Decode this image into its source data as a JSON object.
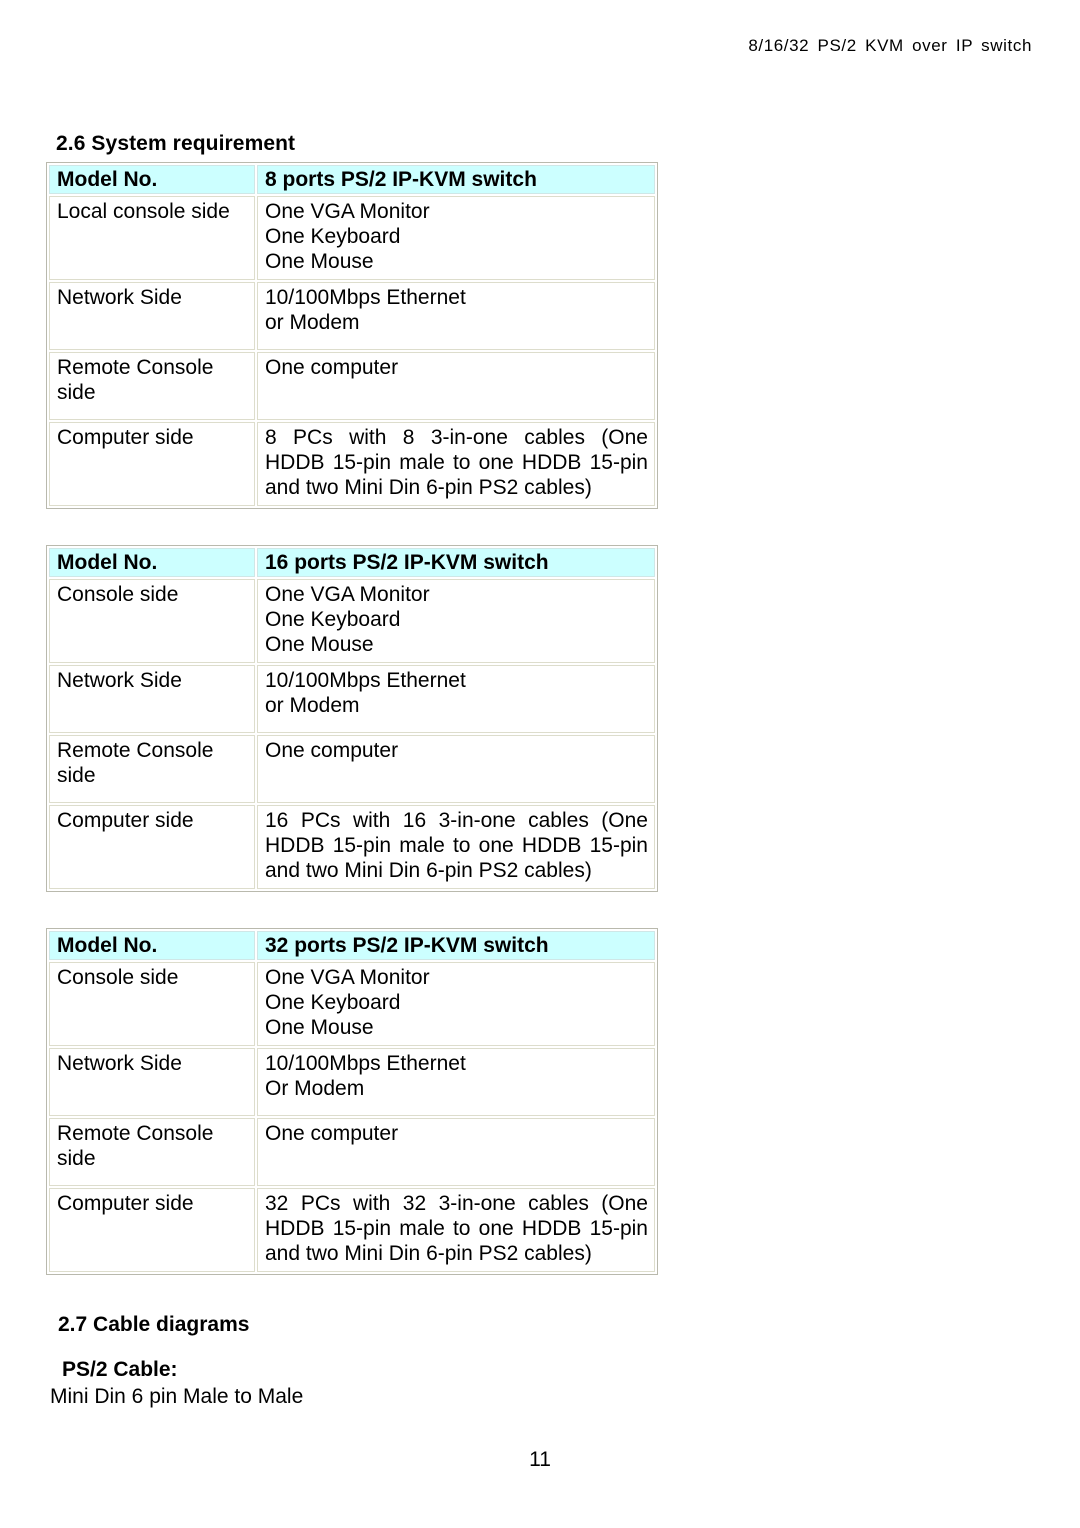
{
  "header": {
    "running_title": "8/16/32 PS/2 KVM over IP switch"
  },
  "sections": {
    "system_requirement": {
      "heading": "2.6 System requirement"
    },
    "cable_diagrams": {
      "heading": "2.7 Cable diagrams",
      "sub_heading": "PS/2 Cable:",
      "description": "Mini Din 6 pin Male to Male"
    }
  },
  "tables": [
    {
      "header": {
        "col1": "Model No.",
        "col2": "8 ports PS/2 IP-KVM switch"
      },
      "rows": [
        {
          "label": "Local console side",
          "lines": [
            "One VGA Monitor",
            "One Keyboard",
            "One Mouse"
          ]
        },
        {
          "label": "Network Side",
          "lines": [
            "10/100Mbps Ethernet",
            "or Modem"
          ]
        },
        {
          "label": "Remote Console side",
          "lines": [
            "One computer"
          ]
        },
        {
          "label": "Computer side",
          "lines": [
            "8 PCs with 8 3-in-one cables (One",
            "HDDB 15-pin male to one HDDB 15-pin",
            "and two Mini Din 6-pin PS2 cables)"
          ]
        }
      ]
    },
    {
      "header": {
        "col1": "Model No.",
        "col2": "16 ports PS/2 IP-KVM switch"
      },
      "rows": [
        {
          "label": "Console side",
          "lines": [
            "One VGA Monitor",
            "One Keyboard",
            "One Mouse"
          ]
        },
        {
          "label": "Network Side",
          "lines": [
            "10/100Mbps Ethernet",
            "or Modem"
          ]
        },
        {
          "label": "Remote Console side",
          "lines": [
            "One computer"
          ]
        },
        {
          "label": "Computer side",
          "lines": [
            "16 PCs with 16 3-in-one cables (One",
            "HDDB 15-pin male to one HDDB 15-pin",
            "and two Mini Din 6-pin PS2 cables)"
          ]
        }
      ]
    },
    {
      "header": {
        "col1": "Model No.",
        "col2": "32 ports PS/2 IP-KVM switch"
      },
      "rows": [
        {
          "label": "Console side",
          "lines": [
            "One VGA Monitor",
            "One Keyboard",
            "One Mouse"
          ]
        },
        {
          "label": "Network Side",
          "lines": [
            "10/100Mbps Ethernet",
            "Or Modem"
          ]
        },
        {
          "label": "Remote Console side",
          "lines": [
            "One computer"
          ]
        },
        {
          "label": "Computer side",
          "lines": [
            "32 PCs with 32 3-in-one cables (One",
            "HDDB 15-pin male to one HDDB 15-pin",
            "and two Mini Din 6-pin PS2 cables)"
          ]
        }
      ]
    }
  ],
  "footer": {
    "page_number": "11"
  },
  "colors": {
    "header_cell_background": "#ccffff",
    "table_border": "#b9b9ad",
    "cell_border": "#ddddcc",
    "text": "#000000"
  }
}
